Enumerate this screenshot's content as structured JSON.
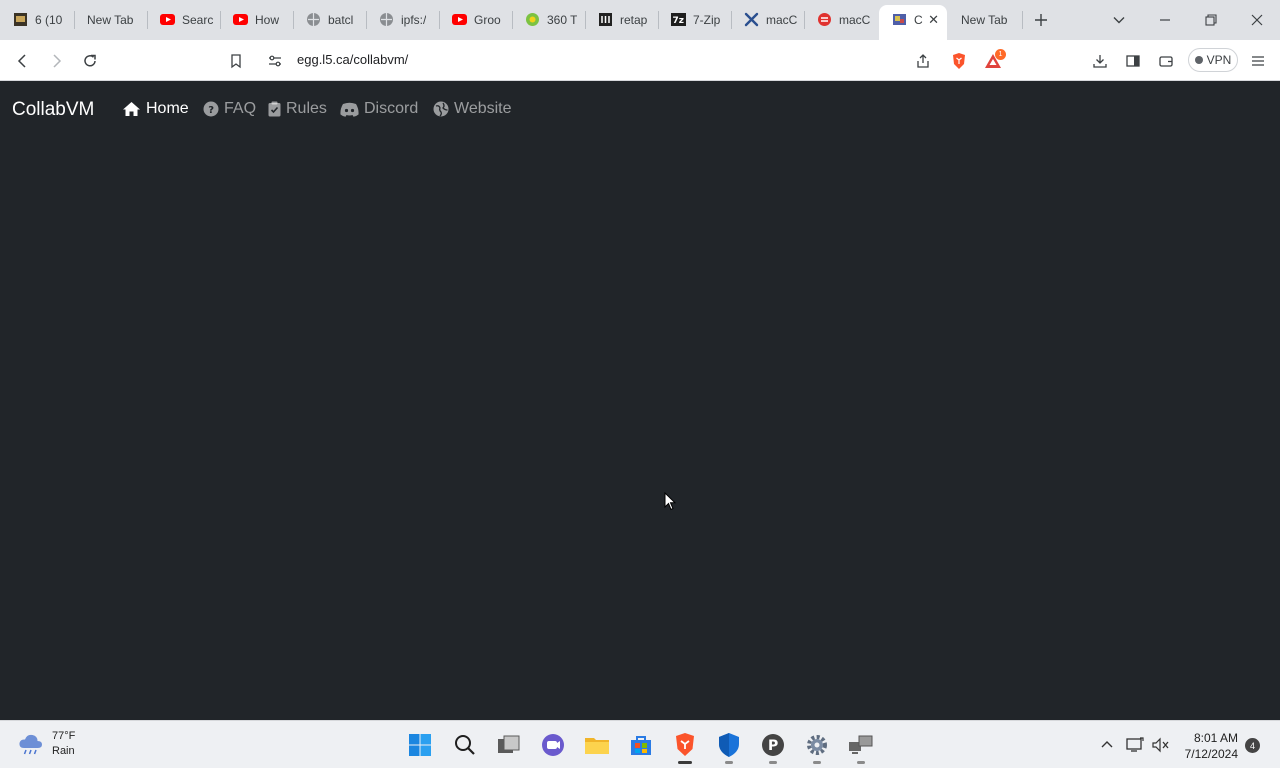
{
  "browser": {
    "tabs": [
      {
        "label": "6 (10",
        "icon": "game-favicon"
      },
      {
        "label": "New Tab",
        "icon": ""
      },
      {
        "label": "Searc",
        "icon": "youtube-favicon"
      },
      {
        "label": "How",
        "icon": "youtube-favicon"
      },
      {
        "label": "batcl",
        "icon": "globe-favicon"
      },
      {
        "label": "ipfs:/",
        "icon": "globe-favicon"
      },
      {
        "label": "Groo",
        "icon": "youtube-favicon"
      },
      {
        "label": "360 T",
        "icon": "360-favicon"
      },
      {
        "label": "retap",
        "icon": "archive-favicon"
      },
      {
        "label": "7-Zip",
        "icon": "7zip-favicon"
      },
      {
        "label": "macC",
        "icon": "x-favicon"
      },
      {
        "label": "macC",
        "icon": "red-favicon"
      },
      {
        "label": "C",
        "icon": "collabvm-favicon",
        "active": true
      },
      {
        "label": "New Tab",
        "icon": ""
      }
    ],
    "url": "egg.l5.ca/collabvm/",
    "vpn_label": "VPN",
    "brave_rewards_badge": "1"
  },
  "site": {
    "brand": "CollabVM",
    "nav": {
      "home": "Home",
      "faq": "FAQ",
      "rules": "Rules",
      "discord": "Discord",
      "website": "Website"
    }
  },
  "taskbar": {
    "weather_temp": "77°F",
    "weather_desc": "Rain",
    "time": "8:01 AM",
    "date": "7/12/2024",
    "notification_count": "4"
  },
  "colors": {
    "page_bg": "#212529",
    "nav_active": "#ffffff",
    "nav_inactive": "rgba(255,255,255,0.55)"
  }
}
